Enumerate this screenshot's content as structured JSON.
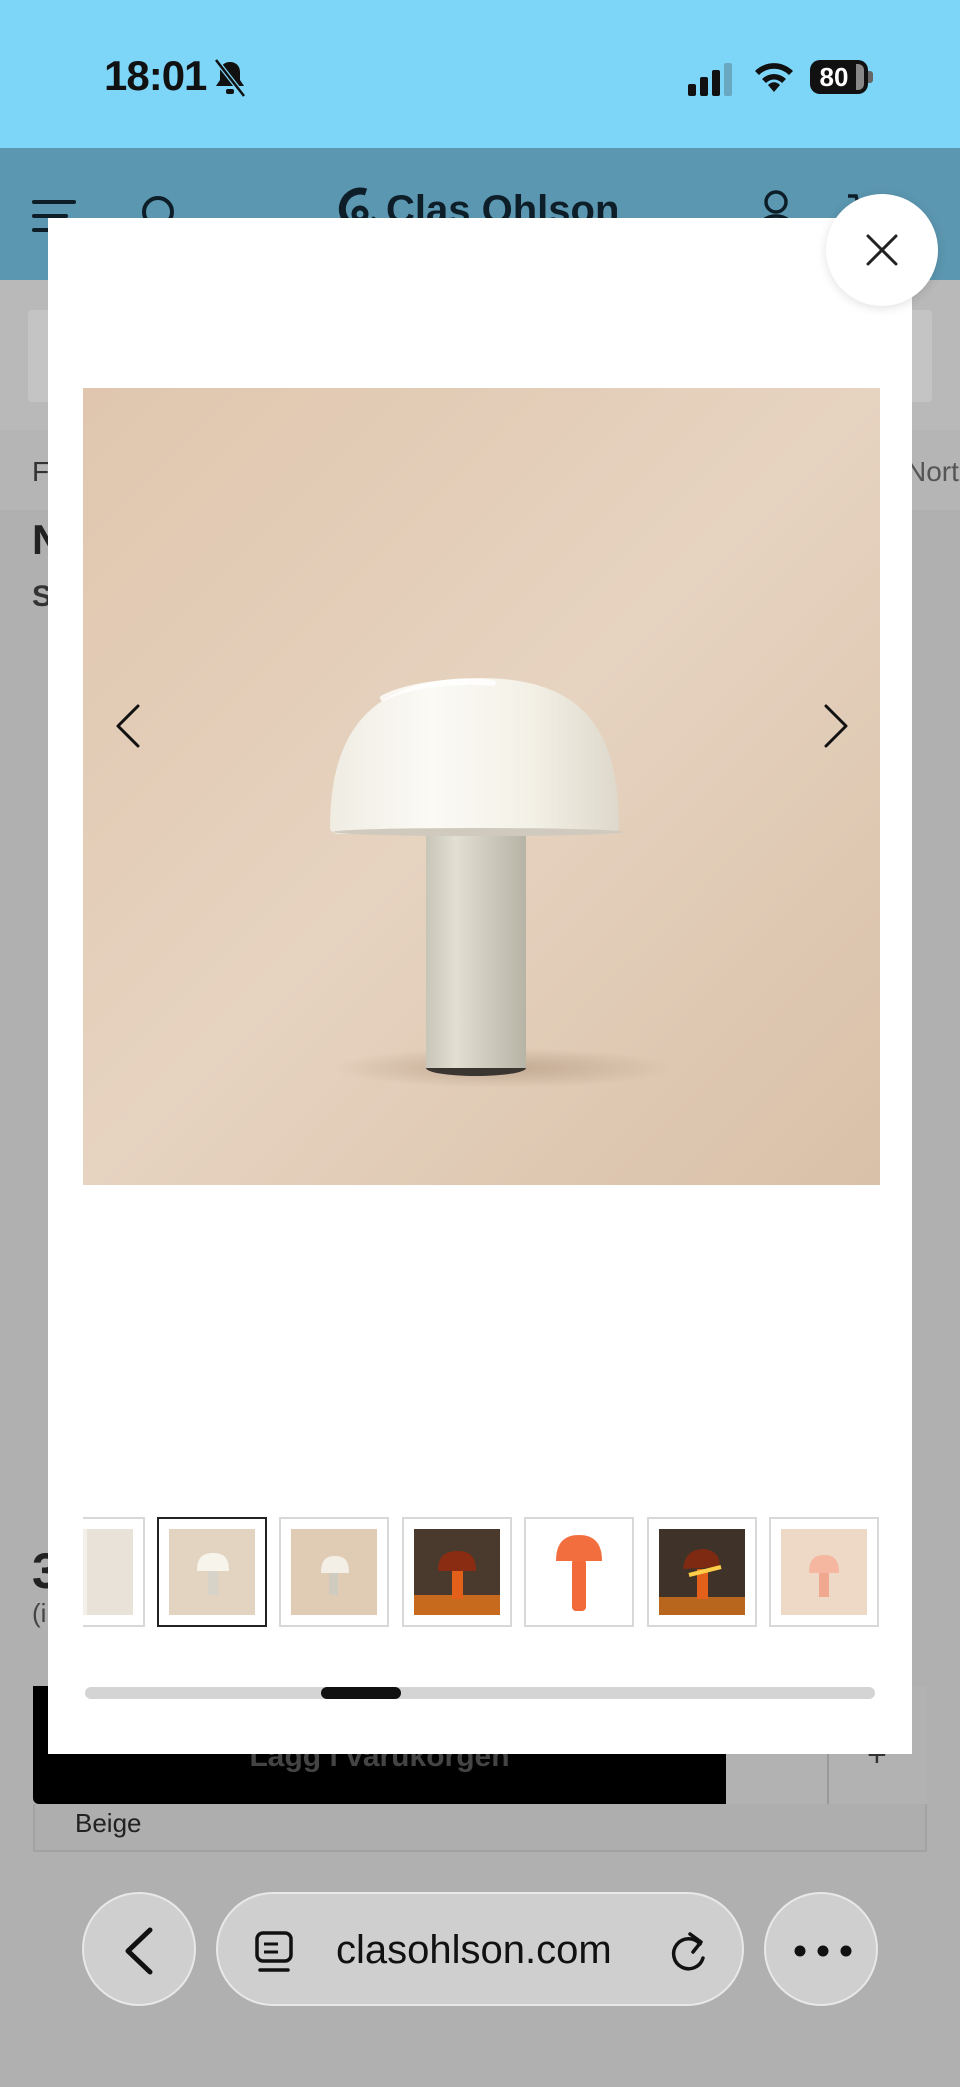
{
  "status_bar": {
    "time": "18:01",
    "battery_level": "80",
    "icons": [
      "bell-muted-icon",
      "signal-icon",
      "wifi-icon",
      "battery-icon"
    ]
  },
  "site": {
    "brand": "Clas Ohlson",
    "breadcrumb_left": "F",
    "breadcrumb_right": "Nort",
    "title_fragment": "N",
    "subtitle_fragment": "S",
    "price_fragment": "3",
    "price_note_fragment": "(i",
    "add_to_cart_label": "Lägg i varukorgen",
    "variant_label": "Beige",
    "qty_plus": "+"
  },
  "gallery": {
    "image_description_icon": "mushroom-lamp-photo",
    "selected_index": 1,
    "thumbnails": [
      {
        "variant": "partial-white",
        "bg": "#f4efe8"
      },
      {
        "variant": "beige-lamp-front",
        "bg": "#e3d3c1"
      },
      {
        "variant": "beige-lamp-angle",
        "bg": "#e0cbb4"
      },
      {
        "variant": "lamp-lit-dark",
        "bg": "#4a3a2e"
      },
      {
        "variant": "orange-lamp",
        "bg": "#ffffff"
      },
      {
        "variant": "lamp-lit-open",
        "bg": "#3f3228"
      },
      {
        "variant": "peach-lamp",
        "bg": "#eed9c6"
      }
    ],
    "scroll_progress": 0.3
  },
  "browser": {
    "url": "clasohlson.com"
  },
  "colors": {
    "status_bg": "#7dd6f8",
    "header_bg": "#5b97b0",
    "scroll_thumb": "#111111"
  }
}
